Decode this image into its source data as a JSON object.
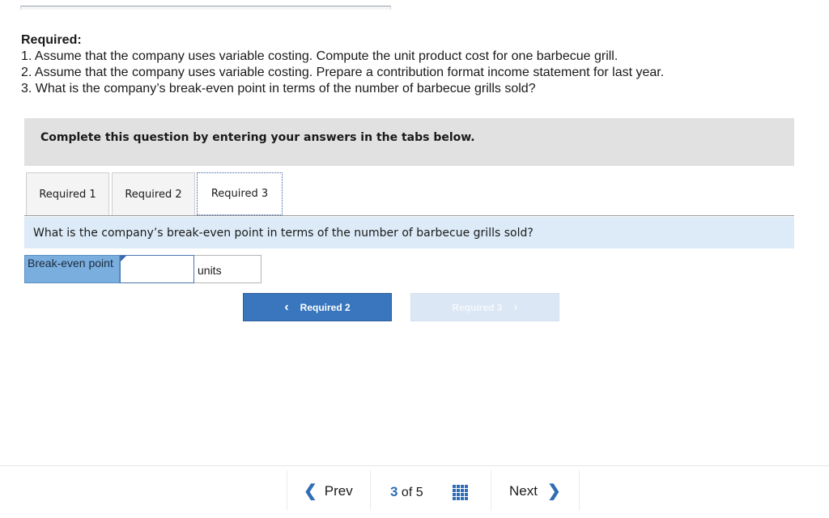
{
  "required": {
    "heading": "Required:",
    "items": [
      "1. Assume that the company uses variable costing. Compute the unit product cost for one barbecue grill.",
      "2. Assume that the company uses variable costing. Prepare a contribution format income statement for last year.",
      "3. What is the company’s break-even point in terms of the number of barbecue grills sold?"
    ]
  },
  "instruction": "Complete this question by entering your answers in the tabs below.",
  "tabs": [
    {
      "label": "Required 1"
    },
    {
      "label": "Required 2"
    },
    {
      "label": "Required 3",
      "active": true
    }
  ],
  "question": "What is the company’s break-even point in terms of the number of barbecue grills sold?",
  "answer_row": {
    "label": "Break-even point",
    "value": "",
    "unit": "units"
  },
  "nav_buttons": {
    "prev_label": "Required 2",
    "next_label": "Required 3",
    "next_disabled": true
  },
  "pager": {
    "prev_label": "Prev",
    "current": "3",
    "of_text": "of 5",
    "next_label": "Next"
  },
  "colors": {
    "accent": "#3a76bd",
    "label_cell": "#7aaedf",
    "question_bar": "#dcebf7",
    "instruction_box": "#e1e1e1"
  },
  "icons": [
    "chevron-left-icon",
    "chevron-right-icon",
    "grid-icon"
  ]
}
